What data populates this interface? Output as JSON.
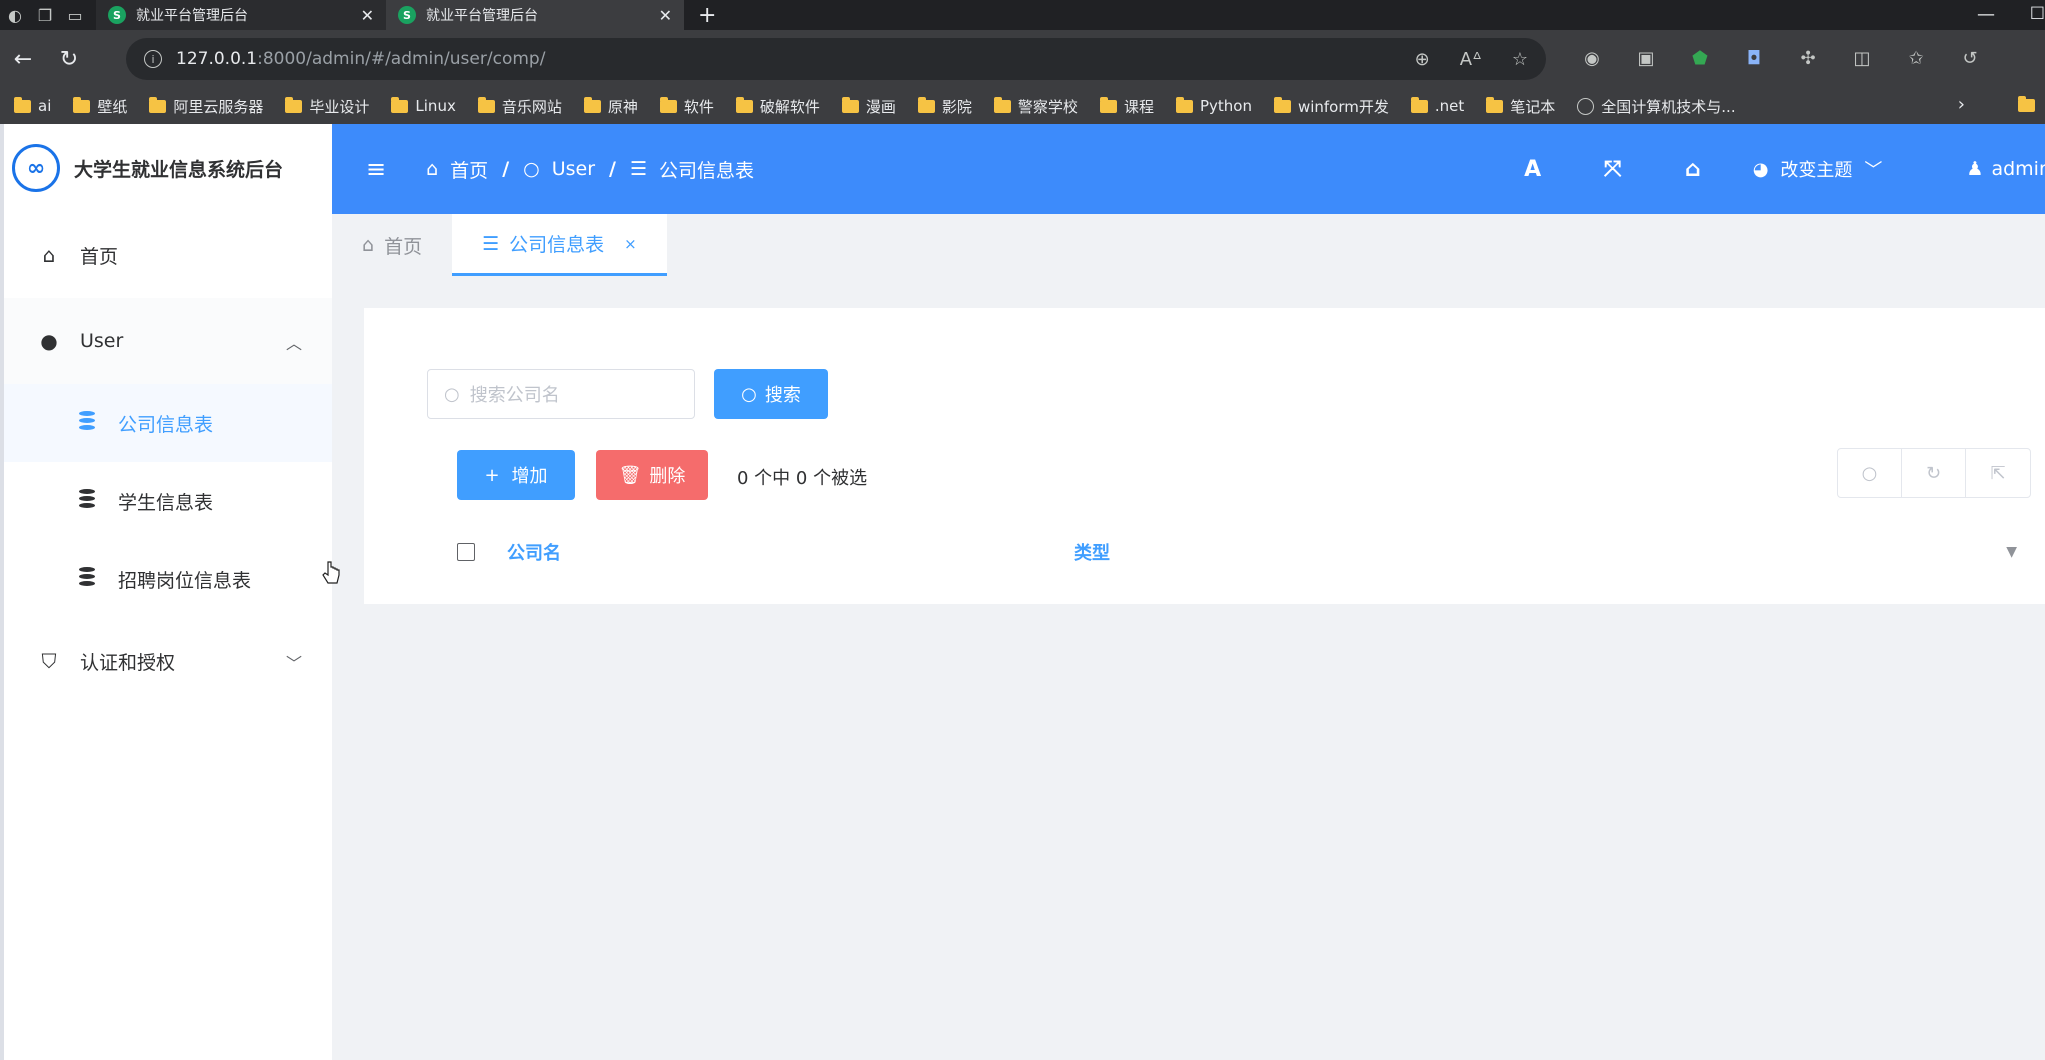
{
  "browser": {
    "tabs": [
      {
        "title": "就业平台管理后台",
        "favicon": "S"
      },
      {
        "title": "就业平台管理后台",
        "favicon": "S"
      }
    ],
    "url_host": "127.0.0.1",
    "url_rest": ":8000/admin/#/admin/user/comp/",
    "bookmarks": [
      "ai",
      "壁纸",
      "阿里云服务器",
      "毕业设计",
      "Linux",
      "音乐网站",
      "原神",
      "软件",
      "破解软件",
      "漫画",
      "影院",
      "警察学校",
      "课程",
      "Python",
      "winform开发",
      ".net",
      "笔记本"
    ],
    "bookmark_globe": "全国计算机技术与..."
  },
  "sidebar": {
    "logo_text": "∞",
    "title": "大学生就业信息系统后台",
    "home": "首页",
    "group_user": "User",
    "items": [
      "公司信息表",
      "学生信息表",
      "招聘岗位信息表"
    ],
    "group_auth": "认证和授权"
  },
  "header": {
    "crumb_home": "首页",
    "crumb_user": "User",
    "crumb_current": "公司信息表",
    "font_icon_label": "A",
    "theme_label": "改变主题",
    "user_name": "admin"
  },
  "tabs": {
    "home": "首页",
    "current": "公司信息表",
    "close": "×"
  },
  "toolbar": {
    "search_placeholder": "搜索公司名",
    "search_label": "搜索",
    "add_label": "增加",
    "delete_label": "删除",
    "selection_text": "0 个中 0 个被选"
  },
  "table": {
    "columns": [
      "公司名",
      "类型"
    ]
  },
  "colors": {
    "primary": "#409eff",
    "header_bg": "#3d8bfb",
    "danger": "#f56c6c"
  }
}
